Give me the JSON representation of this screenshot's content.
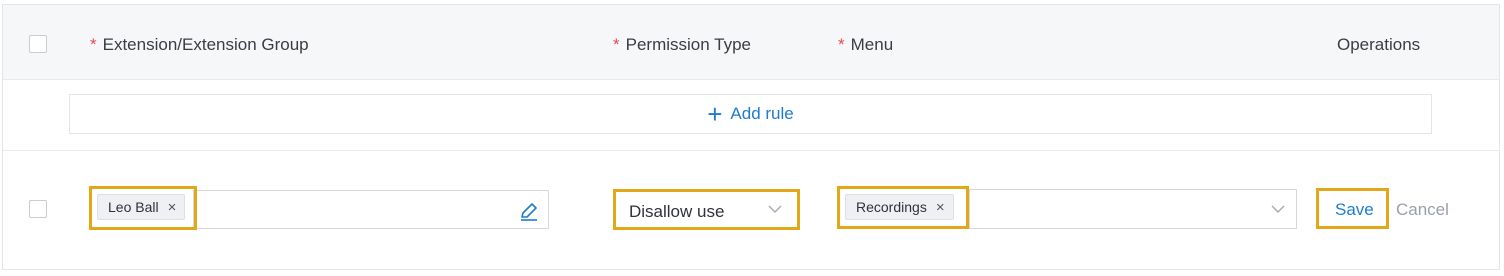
{
  "header": {
    "extension_label": "Extension/Extension Group",
    "permission_label": "Permission Type",
    "menu_label": "Menu",
    "operations_label": "Operations",
    "required_mark": "*"
  },
  "add_rule": {
    "label": "Add rule",
    "icon": "plus-icon"
  },
  "row": {
    "extension_tag": "Leo Ball",
    "permission_value": "Disallow use",
    "menu_tag": "Recordings",
    "save_label": "Save",
    "cancel_label": "Cancel"
  },
  "colors": {
    "accent": "#1d7ccf",
    "highlight": "#e3a819",
    "required": "#e5484d",
    "header_bg": "#f6f7f9"
  }
}
